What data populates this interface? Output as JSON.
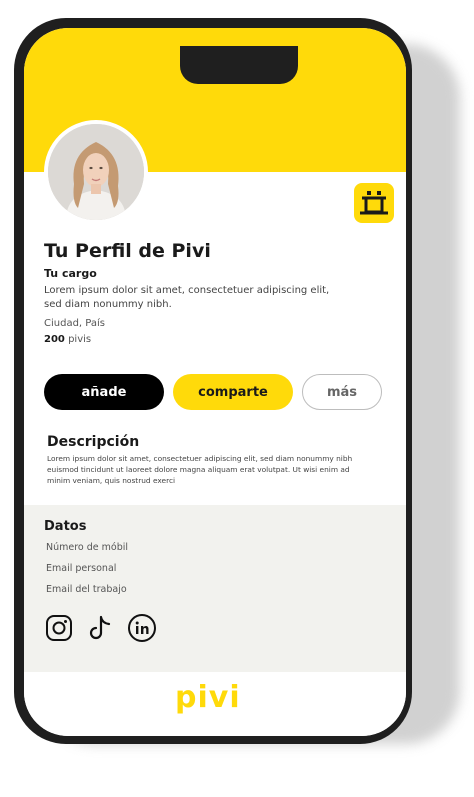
{
  "profile": {
    "name": "Tu Perfil de Pivi",
    "cargo": "Tu cargo",
    "bio": "Lorem ipsum dolor sit amet, consectetuer adipiscing elit, sed diam nonummy nibh.",
    "city": "Ciudad, País",
    "pivis_count": "200",
    "pivis_label": "pivis"
  },
  "actions": {
    "add_label": "añade",
    "share_label": "comparte",
    "more_label": "más"
  },
  "description": {
    "title": "Descripción",
    "text": "Lorem ipsum dolor sit amet, consectetuer adipiscing elit, sed diam nonummy nibh euismod tincidunt ut laoreet dolore magna aliquam erat volutpat. Ut wisi enim ad minim veniam, quis nostrud exerci"
  },
  "datos": {
    "title": "Datos",
    "items": [
      "Número de móbil",
      "Email personal",
      "Email del trabajo"
    ]
  },
  "social": {
    "icons": [
      "instagram-icon",
      "tiktok-icon",
      "linkedin-icon"
    ]
  },
  "brand": {
    "logo_text": "pivi",
    "accent_color": "#FFDA0A"
  }
}
